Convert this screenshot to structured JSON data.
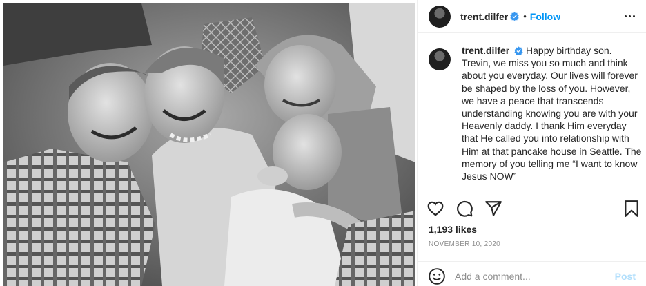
{
  "post": {
    "username": "trent.dilfer",
    "separator": "•",
    "follow_label": "Follow",
    "caption": "Happy birthday son. Trevin, we miss you so much and think about you everyday. Our lives will forever be shaped by the loss of you. However, we have a peace that transcends understanding knowing you are with your Heavenly daddy. I thank Him everyday that He called you into relationship with Him at that pancake house in Seattle. The memory of you telling me “I want to know Jesus NOW”",
    "likes": "1,193 likes",
    "date": "NOVEMBER 10, 2020"
  },
  "comment": {
    "placeholder": "Add a comment...",
    "post_label": "Post"
  },
  "icons": {
    "header": [
      "verified-badge-icon",
      "more-options-icon"
    ],
    "actions": [
      "heart-icon",
      "comment-icon",
      "share-icon",
      "bookmark-icon"
    ],
    "comment": [
      "emoji-icon"
    ]
  },
  "colors": {
    "accent": "#0095f6",
    "post_disabled": "#b2dffc",
    "muted": "#8e8e8e",
    "text": "#262626",
    "divider": "#efefef"
  }
}
